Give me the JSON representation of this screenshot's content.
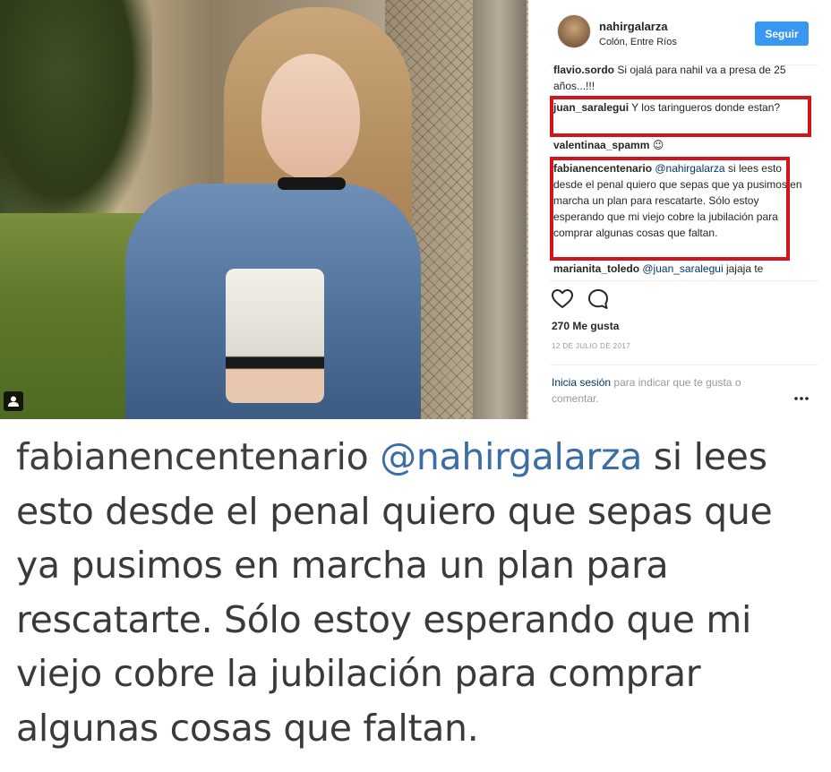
{
  "post": {
    "username": "nahirgalarza",
    "location": "Colón, Entre Ríos",
    "follow_label": "Seguir"
  },
  "comments": [
    {
      "author": "flavio.sordo",
      "mention": "",
      "text": "Si ojalá para nahil va a presa de 25 años...!!!"
    },
    {
      "author": "juan_saralegui",
      "mention": "",
      "text": "Y los taringueros donde estan?"
    },
    {
      "author": "valentinaa_spamm",
      "mention": "",
      "text": "😉"
    },
    {
      "author": "fabianencentenario",
      "mention": "@nahirgalarza",
      "text": "si lees esto desde el penal quiero que sepas que ya pusimos en marcha un plan para rescatarte. Sólo estoy esperando que mi viejo cobre la jubilación para comprar algunas cosas que faltan."
    },
    {
      "author": "marianita_toledo",
      "mention": "@juan_saralegui",
      "text": "jajaja te"
    }
  ],
  "actions": {
    "like_icon": "heart-icon",
    "comment_icon": "speech-bubble-icon",
    "more_icon": "ellipsis-icon"
  },
  "likes_text": "270 Me gusta",
  "date_text": "12 DE JULIO DE 2017",
  "login": {
    "link_text": "Inicia sesión",
    "rest_text": "para indicar que te gusta o comentar."
  },
  "zoomed_comment": {
    "author": "fabianencentenario",
    "mention": "@nahirgalarza",
    "text": "si lees esto desde el penal quiero que sepas que ya pusimos en marcha un plan para rescatarte. Sólo estoy esperando que mi viejo cobre la jubilación para comprar algunas cosas que faltan."
  },
  "colors": {
    "follow_button": "#3897f0",
    "highlight_box": "#d4141c",
    "mention_link": "#003569",
    "zoom_mention": "#3b6ea5"
  }
}
